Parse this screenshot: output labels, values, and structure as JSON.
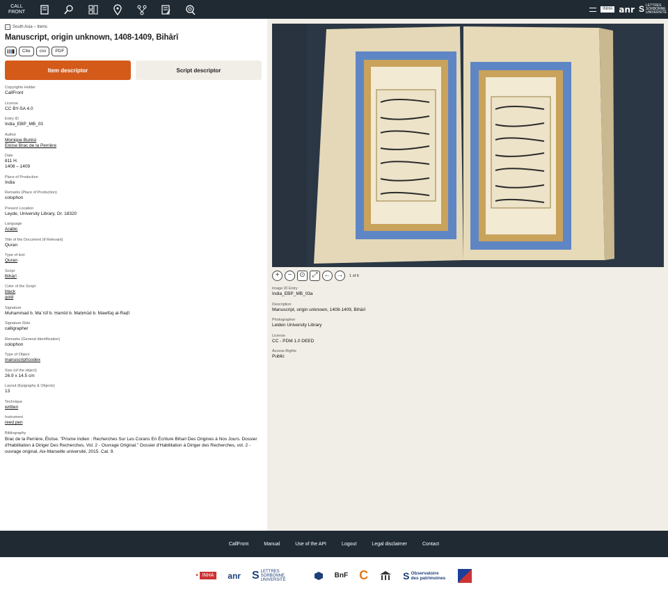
{
  "topbar": {
    "brand_line1": "CALL",
    "brand_line2": "FRONT",
    "icons": [
      "book-icon",
      "search-icon",
      "grid-icon",
      "location-pin-icon",
      "network-icon",
      "edit-document-icon",
      "tag-search-icon"
    ],
    "right_logo_inha": "INHA",
    "right_logo_anr": "anr",
    "right_logo_sorbonne": "LETTRES SORBONNE UNIVERSITÉ"
  },
  "breadcrumb": {
    "label": "South Asia – Items"
  },
  "page_title": "Manuscript, origin unknown, 1408-1409, Bihārī",
  "actions": {
    "iiif": "IIIF",
    "cite": "Cite",
    "csv": "csv",
    "pdf": "PDF"
  },
  "tabs": {
    "item_descriptor": "Item descriptor",
    "script_descriptor": "Script descriptor"
  },
  "fields": [
    {
      "label": "Copyrights Holder",
      "values": [
        "CallFront"
      ],
      "link": false
    },
    {
      "label": "License",
      "values": [
        "CC BY-SA 4.0"
      ],
      "link": false
    },
    {
      "label": "Entry ID",
      "values": [
        "India_EBP_MB_03"
      ],
      "link": false
    },
    {
      "label": "Author",
      "values": [
        "Monique Burési",
        "Eloïse Brac de la Perrière"
      ],
      "link": true
    },
    {
      "label": "Date",
      "values": [
        "811 H.",
        "1408 – 1409"
      ],
      "link": false
    },
    {
      "label": "Place of Production",
      "values": [
        "India"
      ],
      "link": false
    },
    {
      "label": "Remarks (Place of Production)",
      "values": [
        "colophon"
      ],
      "link": false
    },
    {
      "label": "Present Location",
      "values": [
        "Leyde, University Library, Or. 18320"
      ],
      "link": false
    },
    {
      "label": "Language",
      "values": [
        "Arabic"
      ],
      "link": true
    },
    {
      "label": "Title of the Document (If Relevant)",
      "values": [
        "Quran"
      ],
      "link": false
    },
    {
      "label": "Type of text",
      "values": [
        "Quran"
      ],
      "link": true
    },
    {
      "label": "Script",
      "values": [
        "Bihārī"
      ],
      "link": true
    },
    {
      "label": "Color of the Script",
      "values": [
        "black",
        "gold"
      ],
      "link": true
    },
    {
      "label": "Signature",
      "values": [
        "Muhammad b. Ma`rūf b. Ḥamīd b. Maḥmūd b. Mawfūq al-Raḍī"
      ],
      "link": false
    },
    {
      "label": "Signature Role",
      "values": [
        "calligrapher"
      ],
      "link": false
    },
    {
      "label": "Remarks (General Identification)",
      "values": [
        "colophon"
      ],
      "link": false
    },
    {
      "label": "Type of Object",
      "values": [
        "manuscript\\codex"
      ],
      "link": true
    },
    {
      "label": "Size (of the object)",
      "values": [
        "26.9 x 14.5 cm"
      ],
      "link": false
    },
    {
      "label": "Layout (Epigraphy & Objects)",
      "values": [
        "13"
      ],
      "link": false
    },
    {
      "label": "Technique",
      "values": [
        "written"
      ],
      "link": true
    },
    {
      "label": "Instrument",
      "values": [
        "reed pen"
      ],
      "link": true
    }
  ],
  "bibliography": {
    "label": "Bibliography",
    "value": "Brac de la Perrière, Éloïse. \"Prisme Indien : Recherches Sur Les Corans En Écriture Bihari Des Origines à Nos Jours. Dossier d'Habilitation à Diriger Des Recherches, Vol. 2 - Ouvrage Original.\" Dossier d'Habilitation à Diriger des Recherches, vol. 2 - ouvrage original, Aix-Marseille université, 2015. Cat. 9."
  },
  "viewer": {
    "page_count": "1 of 6",
    "controls": [
      "zoom-in-icon",
      "zoom-out-icon",
      "home-icon",
      "fullscreen-icon",
      "previous-icon",
      "next-icon"
    ]
  },
  "image_fields": [
    {
      "label": "Image ID Entry",
      "value": "India_EBP_MB_03a"
    },
    {
      "label": "Description",
      "value": "Manuscript, origin unknown, 1408-1409, Bihārī"
    },
    {
      "label": "Photographer",
      "value": "Leiden University Library"
    },
    {
      "label": "License",
      "value": "CC - PDM 1.0 DEED"
    },
    {
      "label": "Access Rights",
      "value": "Public"
    }
  ],
  "footer": {
    "links": [
      "CallFront",
      "Manual",
      "Use of the API",
      "Logout",
      "Legal disclaimer",
      "Contact"
    ]
  },
  "partners": [
    "INHA",
    "anr",
    "LETTRES SORBONNE UNIVERSITÉ",
    "BnF",
    "Observatoire des patrimoines"
  ]
}
